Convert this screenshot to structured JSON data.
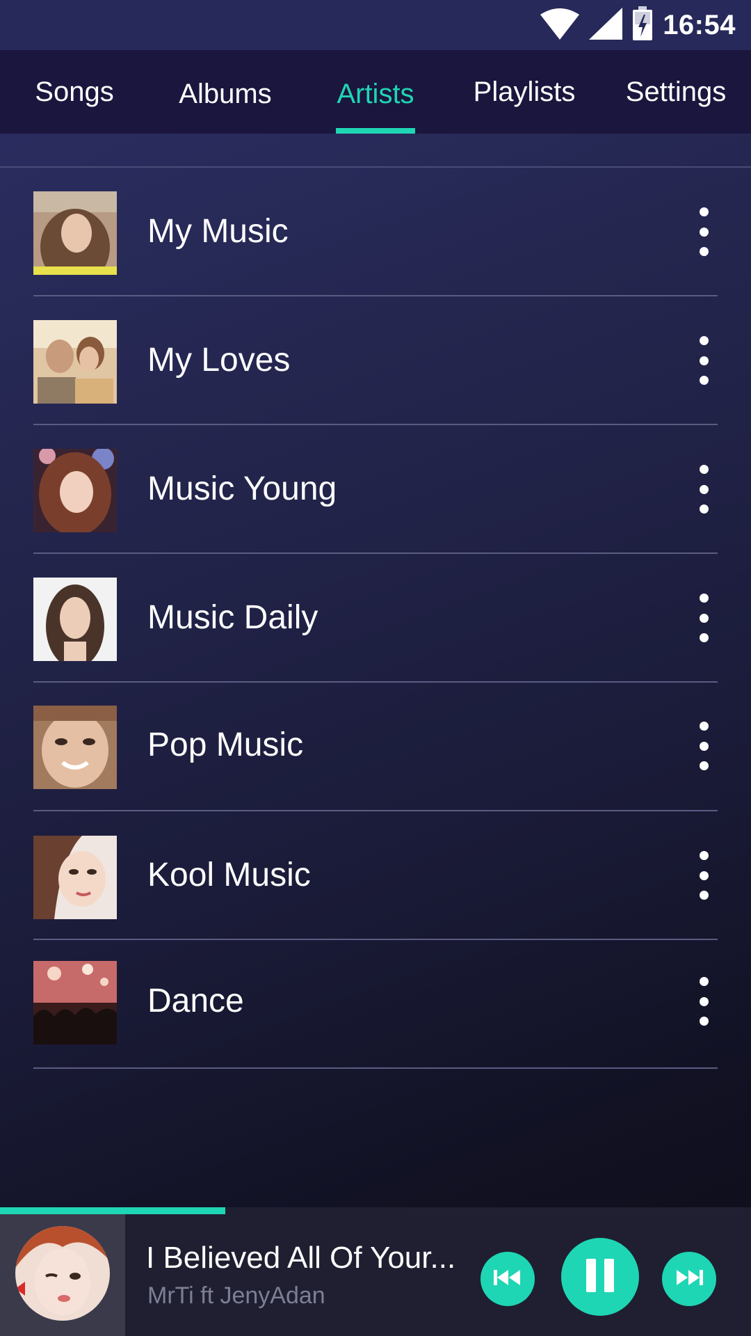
{
  "status_bar": {
    "time": "16:54",
    "icons": [
      "wifi-icon",
      "cell-signal-icon",
      "battery-charging-icon"
    ]
  },
  "tabs": [
    {
      "label": "Songs",
      "active": false
    },
    {
      "label": "Albums",
      "active": false
    },
    {
      "label": "Artists",
      "active": true
    },
    {
      "label": "Playlists",
      "active": false
    },
    {
      "label": "Settings",
      "active": false
    }
  ],
  "list": {
    "items": [
      {
        "label": "My Music",
        "thumbnail": "portrait-photo",
        "menu_icon": "more-vertical-icon"
      },
      {
        "label": "My Loves",
        "thumbnail": "couple-photo",
        "menu_icon": "more-vertical-icon"
      },
      {
        "label": "Music Young",
        "thumbnail": "portrait-photo",
        "menu_icon": "more-vertical-icon"
      },
      {
        "label": "Music Daily",
        "thumbnail": "portrait-photo",
        "menu_icon": "more-vertical-icon"
      },
      {
        "label": "Pop Music",
        "thumbnail": "portrait-photo",
        "menu_icon": "more-vertical-icon"
      },
      {
        "label": "Kool Music",
        "thumbnail": "portrait-photo",
        "menu_icon": "more-vertical-icon"
      },
      {
        "label": "Dance",
        "thumbnail": "concert-photo",
        "menu_icon": "more-vertical-icon"
      }
    ]
  },
  "now_playing": {
    "title": "I Believed All Of Your...",
    "artist": "MrTi ft JenyAdan",
    "progress_fraction": 0.3,
    "is_playing": true,
    "controls": [
      "previous-icon",
      "pause-icon",
      "next-icon"
    ]
  },
  "colors": {
    "accent": "#1fd6b4",
    "tab_bar": "#1a163d",
    "status_bar": "#27295a",
    "player_bg": "#1f1f31",
    "secondary_text": "#7d7f94"
  }
}
